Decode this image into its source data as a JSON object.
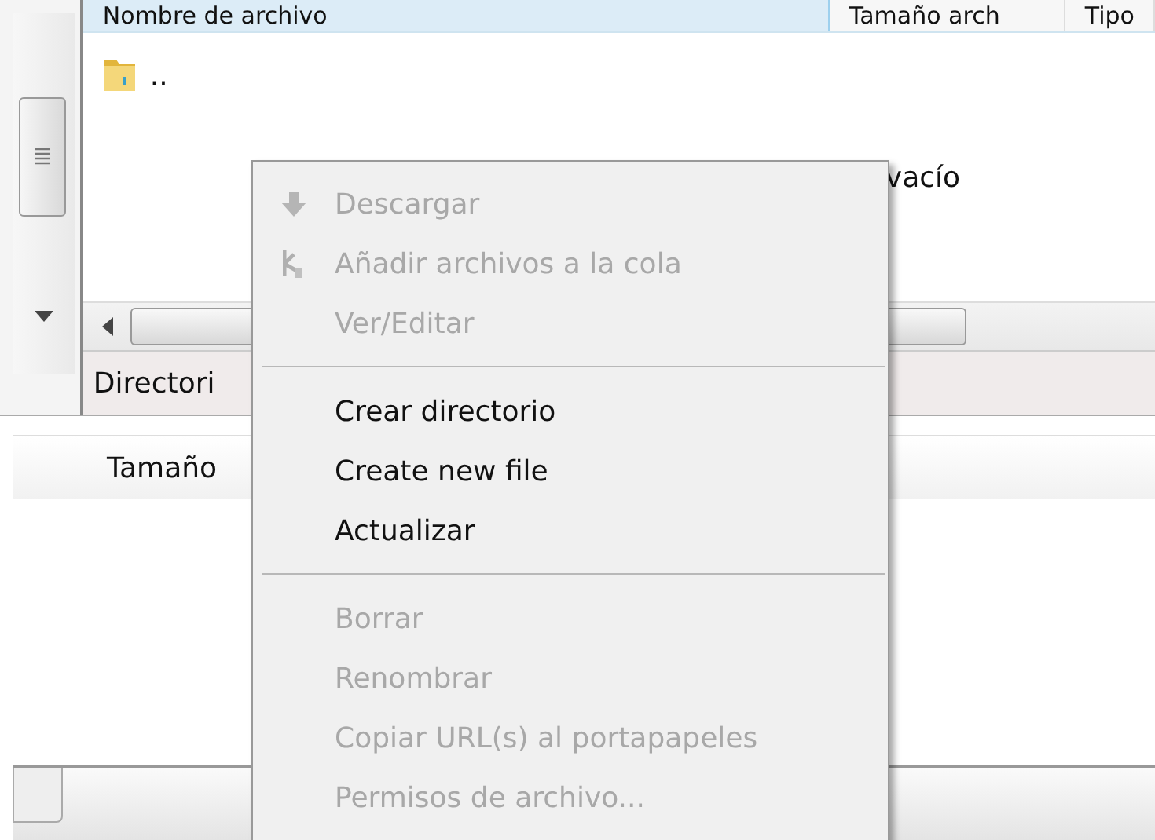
{
  "file_list": {
    "columns": [
      {
        "label": "Nombre de archivo",
        "selected": true
      },
      {
        "label": "Tamaño arch",
        "selected": false
      },
      {
        "label": "Tipo",
        "selected": false
      }
    ],
    "rows": [
      {
        "name": ".."
      }
    ],
    "empty_message": "vacío"
  },
  "status": "Directori",
  "queue": {
    "columns": [
      "Tamaño"
    ]
  },
  "context_menu": [
    {
      "kind": "item",
      "label": "Descargar",
      "disabled": true
    },
    {
      "kind": "item",
      "label": "Añadir archivos a la cola",
      "disabled": true
    },
    {
      "kind": "item",
      "label": "Ver/Editar",
      "disabled": true
    },
    {
      "kind": "separator"
    },
    {
      "kind": "item",
      "label": "Crear directorio",
      "disabled": false
    },
    {
      "kind": "item",
      "label": "Create new file",
      "disabled": false
    },
    {
      "kind": "item",
      "label": "Actualizar",
      "disabled": false
    },
    {
      "kind": "separator"
    },
    {
      "kind": "item",
      "label": "Borrar",
      "disabled": true
    },
    {
      "kind": "item",
      "label": "Renombrar",
      "disabled": true
    },
    {
      "kind": "item",
      "label": "Copiar URL(s) al portapapeles",
      "disabled": true
    },
    {
      "kind": "item",
      "label": "Permisos de archivo...",
      "disabled": true
    }
  ]
}
